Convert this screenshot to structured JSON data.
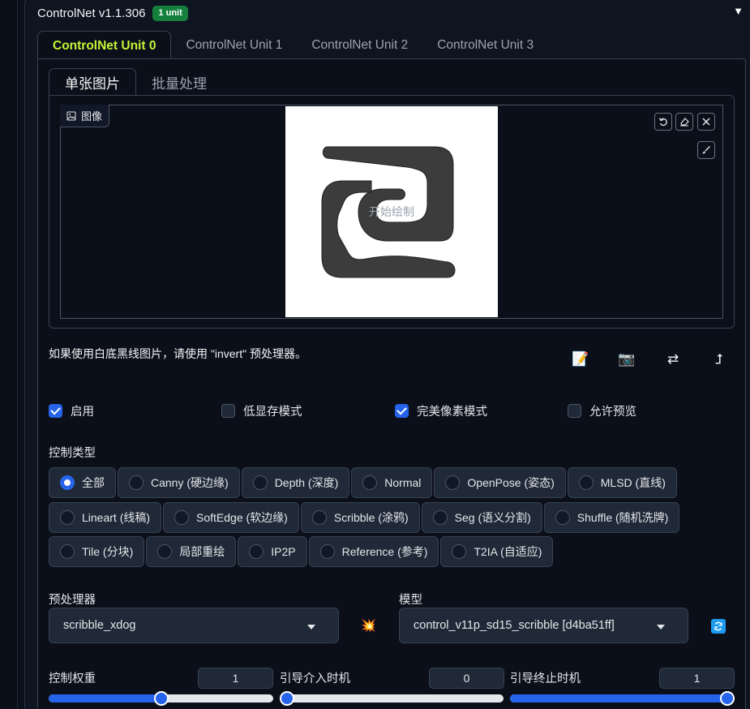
{
  "header": {
    "title": "ControlNet v1.1.306",
    "badge": "1 unit",
    "collapse_glyph": "▼"
  },
  "unit_tabs": [
    "ControlNet Unit 0",
    "ControlNet Unit 1",
    "ControlNet Unit 2",
    "ControlNet Unit 3"
  ],
  "sub_tabs": [
    "单张图片",
    "批量处理"
  ],
  "image": {
    "label": "图像",
    "canvas_hint": "开始绘制"
  },
  "hint_text": "如果使用白底黑线图片，请使用 \"invert\" 预处理器。",
  "checkboxes": [
    {
      "label": "启用",
      "checked": true
    },
    {
      "label": "低显存模式",
      "checked": false
    },
    {
      "label": "完美像素模式",
      "checked": true
    },
    {
      "label": "允许预览",
      "checked": false
    }
  ],
  "control_type": {
    "label": "控制类型",
    "selected": "全部",
    "rows": [
      [
        "全部",
        "Canny (硬边缘)",
        "Depth (深度)",
        "Normal",
        "OpenPose (姿态)",
        "MLSD (直线)"
      ],
      [
        "Lineart (线稿)",
        "SoftEdge (软边缘)",
        "Scribble (涂鸦)",
        "Seg (语义分割)",
        "Shuffle (随机洗牌)"
      ],
      [
        "Tile (分块)",
        "局部重绘",
        "IP2P",
        "Reference (参考)",
        "T2IA (自适应)"
      ]
    ]
  },
  "preprocessor": {
    "label": "预处理器",
    "value": "scribble_xdog"
  },
  "model": {
    "label": "模型",
    "value": "control_v11p_sd15_scribble [d4ba51ff]"
  },
  "sliders": [
    {
      "label": "控制权重",
      "value": "1",
      "fraction": 0.5
    },
    {
      "label": "引导介入时机",
      "value": "0",
      "fraction": 0.0
    },
    {
      "label": "引导终止时机",
      "value": "1",
      "fraction": 1.0
    }
  ],
  "colors": {
    "accent": "#2563eb",
    "active_tab": "#c3f537",
    "badge": "#15803d"
  }
}
